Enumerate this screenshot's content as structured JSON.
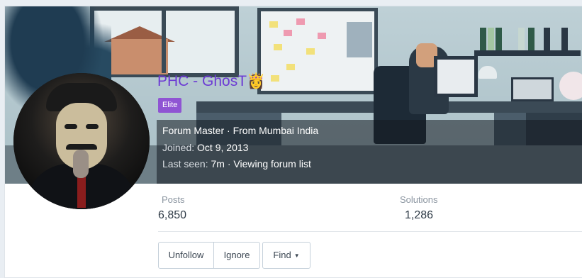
{
  "profile": {
    "username": "PHC - GhosT👸",
    "badge": "Elite",
    "title_line": "Forum Master · From Mumbai India",
    "joined_label": "Joined:",
    "joined_value": "Oct 9, 2013",
    "last_seen_label": "Last seen:",
    "last_seen_value": "7m · Viewing forum list"
  },
  "stats": {
    "posts_label": "Posts",
    "posts_value": "6,850",
    "solutions_label": "Solutions",
    "solutions_value": "1,286"
  },
  "actions": {
    "unfollow": "Unfollow",
    "ignore": "Ignore",
    "find": "Find",
    "find_icon": "caret-down-icon"
  },
  "colors": {
    "username": "#6c3bd4",
    "badge_bg": "#8f54d3",
    "button_border": "#c5d0da"
  }
}
